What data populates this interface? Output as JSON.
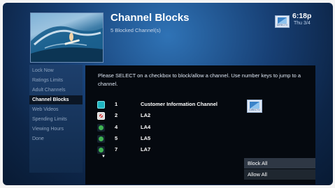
{
  "header": {
    "title": "Channel Blocks",
    "subtitle": "5 Blocked Channel(s)",
    "time": "6:18p",
    "date": "Thu 3/4",
    "logo_text": "DIRECTV"
  },
  "menu": {
    "items": [
      {
        "label": "Lock Now"
      },
      {
        "label": "Ratings Limits"
      },
      {
        "label": "Adult Channels"
      },
      {
        "label": "Channel Blocks"
      },
      {
        "label": "Web Videos"
      },
      {
        "label": "Spending Limits"
      },
      {
        "label": "Viewing Hours"
      },
      {
        "label": "Done"
      }
    ],
    "active": "Channel Blocks"
  },
  "instructions": "Please SELECT on a checkbox to block/allow a channel. Use number keys to jump to a channel.",
  "channels": [
    {
      "number": "1",
      "name": "Customer Information Channel",
      "state": "selected"
    },
    {
      "number": "2",
      "name": "LA2",
      "state": "blocked"
    },
    {
      "number": "4",
      "name": "LA4",
      "state": "allowed"
    },
    {
      "number": "5",
      "name": "LA5",
      "state": "allowed"
    },
    {
      "number": "7",
      "name": "LA7",
      "state": "allowed"
    }
  ],
  "channel_logo_text": "DIRECTV",
  "scroll_indicator": "▼",
  "actions": {
    "block_all": "Block All",
    "allow_all": "Allow All"
  }
}
